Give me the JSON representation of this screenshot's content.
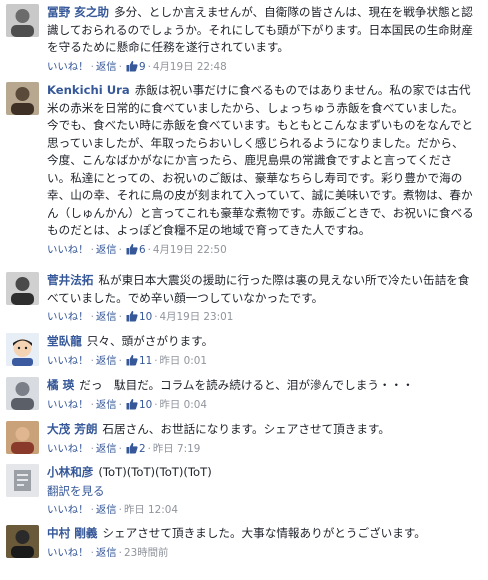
{
  "actions": {
    "like": "いいね！",
    "reply": "返信",
    "separator": "·"
  },
  "comments": [
    {
      "author": "冨野 亥之助",
      "text": "多分、としか言えませんが、自衛隊の皆さんは、現在を戦争状態と認識しておられるのでしょうか。それにしても頭が下がります。日本国民の生命財産を守るために懸命に任務を遂行されています。",
      "like_count": "9",
      "time": "4月19日 22:48",
      "avatar_color": "#6b6b6b"
    },
    {
      "author": "Kenkichi Ura",
      "text": "赤飯は祝い事だけに食べるものではありません。私の家では古代米の赤米を日常的に食べていましたから、しょっちゅう赤飯を食べていました。今でも、食べたい時に赤飯を食べています。もともとこんなまずいものをなんでと思っていましたが、年取ったらおいしく感じられるようになりました。だから、今度、こんなばかがなにか言ったら、鹿児島県の常識食ですよと言ってください。私達にとっての、お祝いのご飯は、豪華なちらし寿司です。彩り豊かで海の幸、山の幸、それに鳥の皮が刻まれて入っていて、誠に美味いです。煮物は、春かん（しゅんかん）と言ってこれも豪華な煮物です。赤飯ごときで、お祝いに食べるものだとは、よっぽど食糧不足の地域で育ってきた人ですね。",
      "like_count": "6",
      "time": "4月19日 22:50",
      "avatar_color": "#5a4a3a"
    },
    {
      "author": "菅井法拓",
      "text": "私が東日本大震災の援助に行った際は裏の見えない所で冷たい缶詰を食べていました。でめ辛い顔一つしていなかったです。",
      "like_count": "10",
      "time": "4月19日 23:01",
      "avatar_color": "#4a4a4a"
    },
    {
      "author": "堂臥龍",
      "text": "只々、頭がさがります。",
      "like_count": "11",
      "time": "昨日 0:01",
      "avatar_color": "#dfe6ef"
    },
    {
      "author": "橘 瑛",
      "text": "だっ　駄目だ。コラムを読み続けると、泪が滲んでしまう・・・",
      "like_count": "10",
      "time": "昨日 0:04",
      "avatar_color": "#7a7f88"
    },
    {
      "author": "大茂 芳朗",
      "text": "石居さん、お世話になります。シェアさせて頂きます。",
      "like_count": "2",
      "time": "昨日 7:19",
      "avatar_color": "#8a3a2a"
    },
    {
      "author": "小林和彦",
      "text": "(ToT)(ToT)(ToT)(ToT)",
      "translate": "翻訳を見る",
      "like_count": "",
      "time": "昨日 12:04",
      "avatar_color": "#9aa0a6"
    },
    {
      "author": "中村 剛義",
      "text": "シェアさせて頂きました。大事な情報ありがとうございます。",
      "like_count": "",
      "time": "23時間前",
      "avatar_color": "#2a2a2a"
    }
  ]
}
